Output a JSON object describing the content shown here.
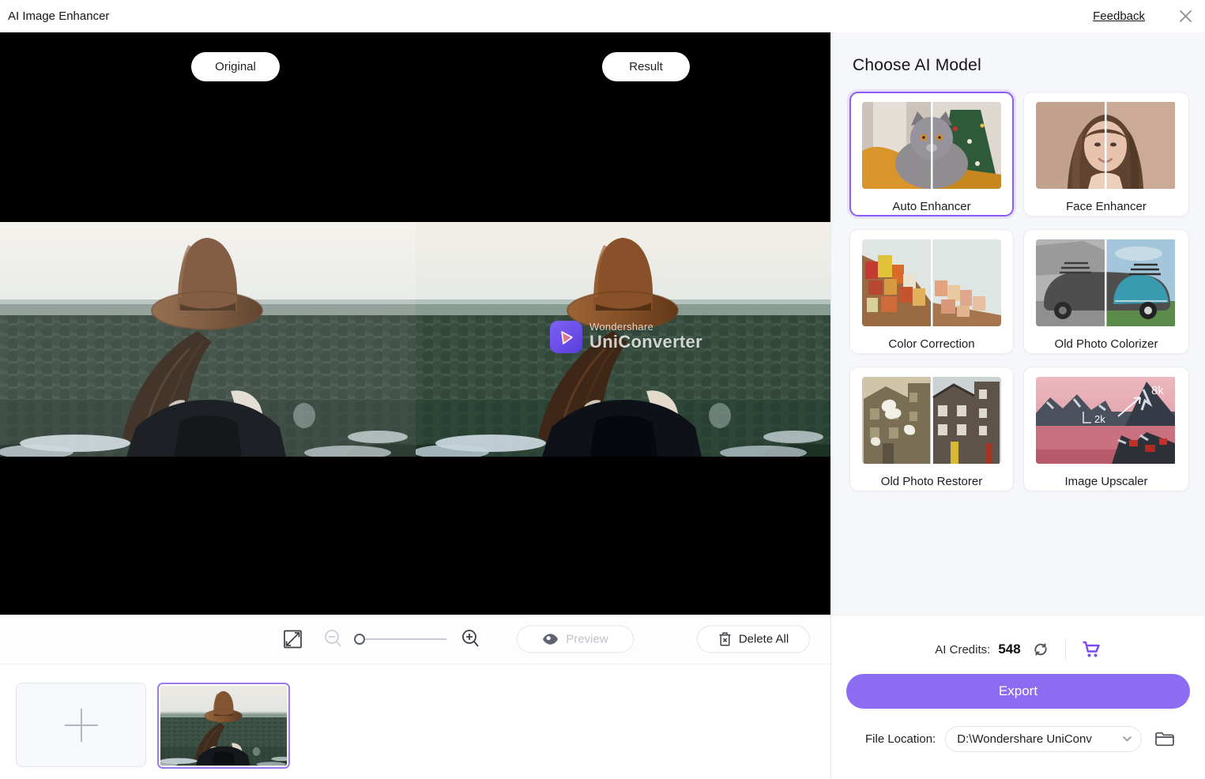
{
  "window": {
    "title": "AI Image Enhancer",
    "feedback": "Feedback"
  },
  "preview": {
    "original_label": "Original",
    "result_label": "Result",
    "watermark": {
      "brand_top": "Wondershare",
      "brand_bottom": "UniConverter"
    }
  },
  "toolbar": {
    "preview_label": "Preview",
    "delete_all_label": "Delete All"
  },
  "panel": {
    "title": "Choose AI Model",
    "models": [
      {
        "label": "Auto Enhancer",
        "selected": true
      },
      {
        "label": "Face Enhancer",
        "selected": false
      },
      {
        "label": "Color Correction",
        "selected": false
      },
      {
        "label": "Old Photo Colorizer",
        "selected": false
      },
      {
        "label": "Old Photo Restorer",
        "selected": false
      },
      {
        "label": "Image Upscaler",
        "selected": false,
        "badges": {
          "small": "2k",
          "large": "8k"
        }
      }
    ],
    "credits": {
      "label": "AI Credits:",
      "value": "548"
    },
    "export_label": "Export",
    "file_location": {
      "label": "File Location:",
      "value": "D:\\Wondershare UniConv"
    }
  },
  "colors": {
    "accent": "#8b5cf6",
    "export_button": "#8e6cf1",
    "cart": "#7c4bf0",
    "canvas": "#000000"
  }
}
